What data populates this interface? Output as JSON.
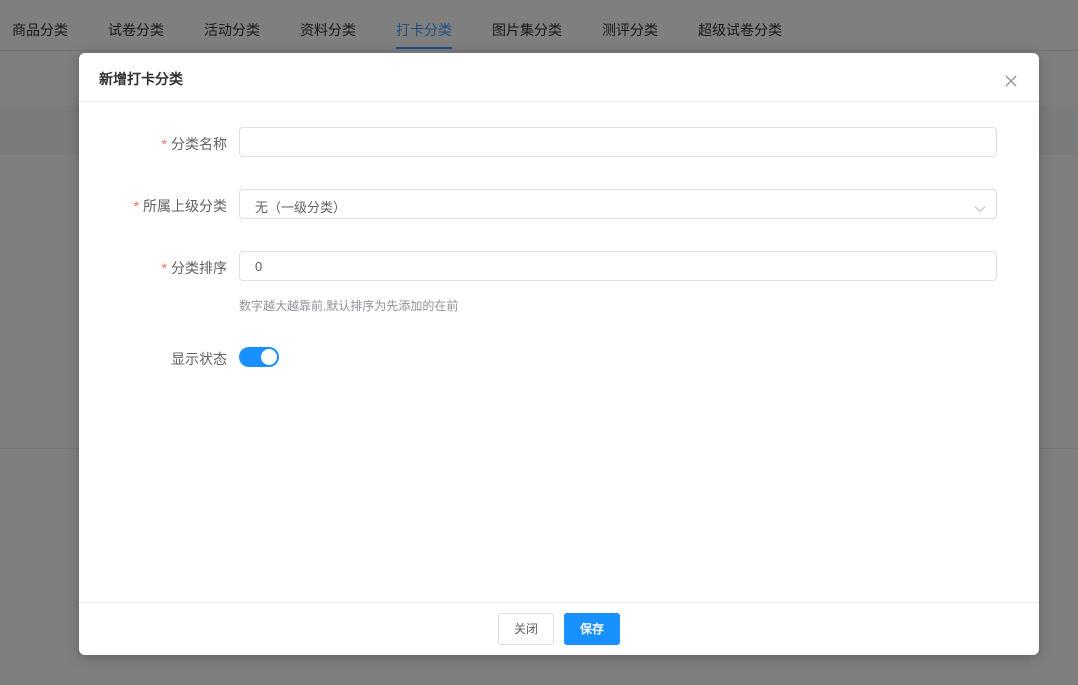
{
  "tabs": [
    {
      "label": "商品分类"
    },
    {
      "label": "试卷分类"
    },
    {
      "label": "活动分类"
    },
    {
      "label": "资料分类"
    },
    {
      "label": "打卡分类",
      "active": true
    },
    {
      "label": "图片集分类"
    },
    {
      "label": "测评分类"
    },
    {
      "label": "超级试卷分类"
    }
  ],
  "dialog": {
    "title": "新增打卡分类",
    "close_icon": "close-icon",
    "fields": {
      "name": {
        "label": "分类名称",
        "required": "*",
        "value": ""
      },
      "parent": {
        "label": "所属上级分类",
        "required": "*",
        "value": "无（一级分类）"
      },
      "sort": {
        "label": "分类排序",
        "required": "*",
        "value": "0",
        "hint": "数字越大越靠前,默认排序为先添加的在前"
      },
      "status": {
        "label": "显示状态",
        "on": true
      }
    },
    "footer": {
      "close_label": "关闭",
      "save_label": "保存"
    }
  },
  "colors": {
    "accent": "#1890ff",
    "required": "#f56c6c",
    "overlay": "rgba(0,0,0,0.5)"
  }
}
